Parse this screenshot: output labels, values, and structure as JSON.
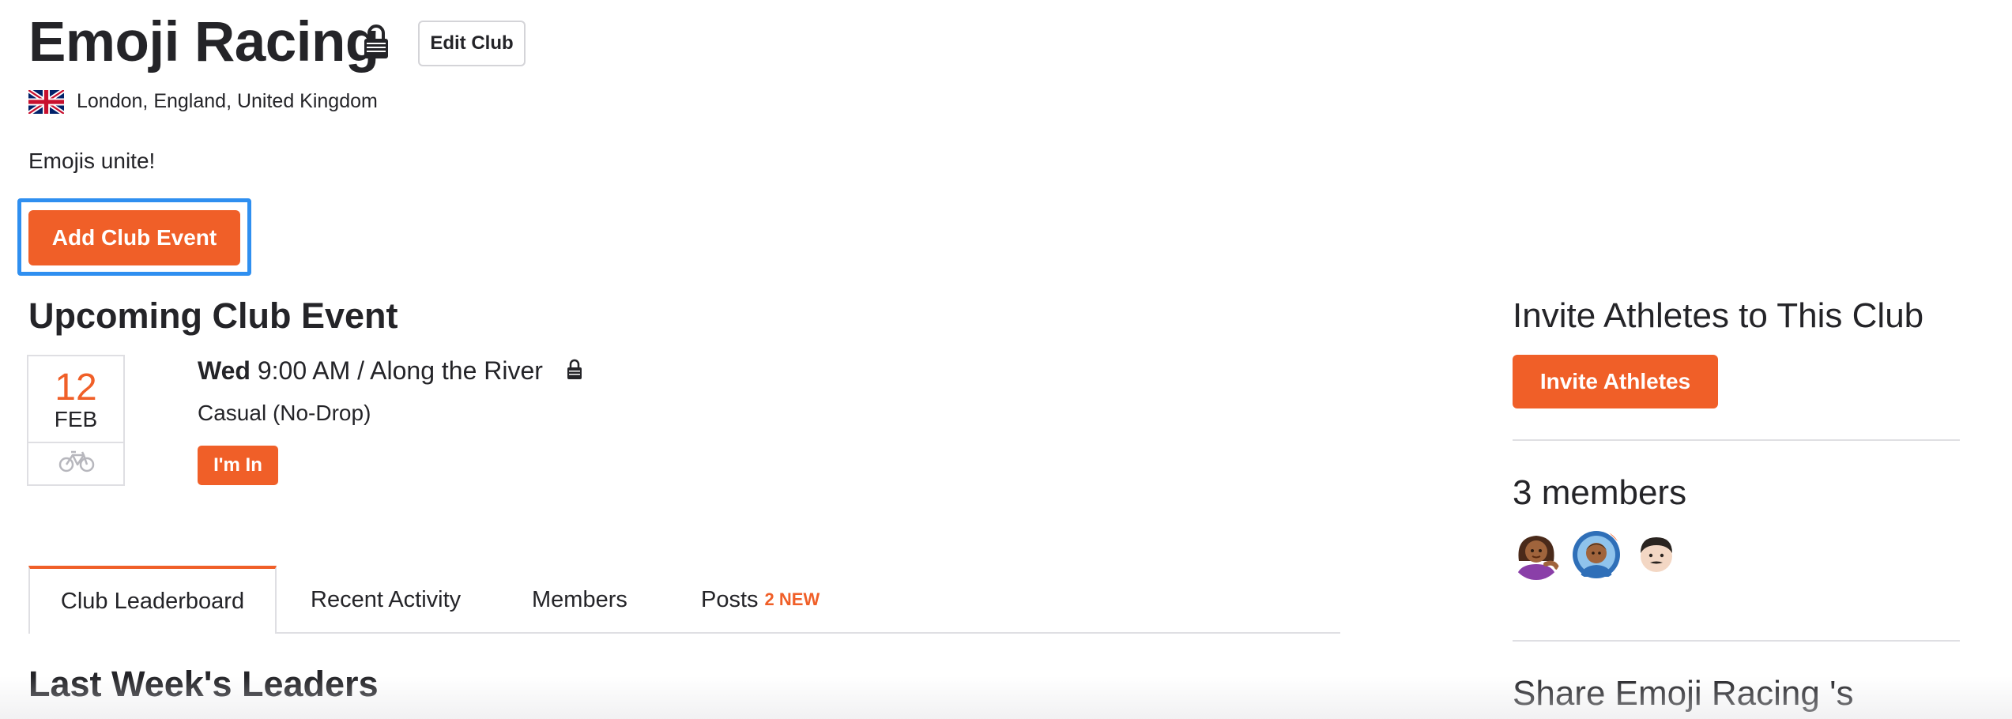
{
  "club": {
    "name": "Emoji Racing",
    "edit_label": "Edit Club",
    "location": "London, England, United Kingdom",
    "country_flag_icon": "uk-flag-icon",
    "description": "Emojis unite!"
  },
  "actions": {
    "add_event_label": "Add Club Event"
  },
  "upcoming": {
    "heading": "Upcoming Club Event",
    "date_day": "12",
    "date_month": "FEB",
    "sport_icon": "bike-icon",
    "weekday": "Wed",
    "time_place": "9:00 AM / Along the River",
    "pace": "Casual (No-Drop)",
    "rsvp_label": "I'm In"
  },
  "tabs": [
    {
      "label": "Club Leaderboard",
      "active": true
    },
    {
      "label": "Recent Activity"
    },
    {
      "label": "Members"
    },
    {
      "label": "Posts",
      "badge": "2 NEW"
    }
  ],
  "leaders": {
    "heading": "Last Week's Leaders"
  },
  "sidebar": {
    "invite_heading": "Invite Athletes to This Club",
    "invite_label": "Invite Athletes",
    "members_heading": "3 members",
    "share_heading": "Share Emoji Racing 's"
  },
  "colors": {
    "accent": "#f05f28",
    "focus_ring": "#2f8ff0",
    "text": "#242428",
    "border": "#dfdfe3"
  }
}
